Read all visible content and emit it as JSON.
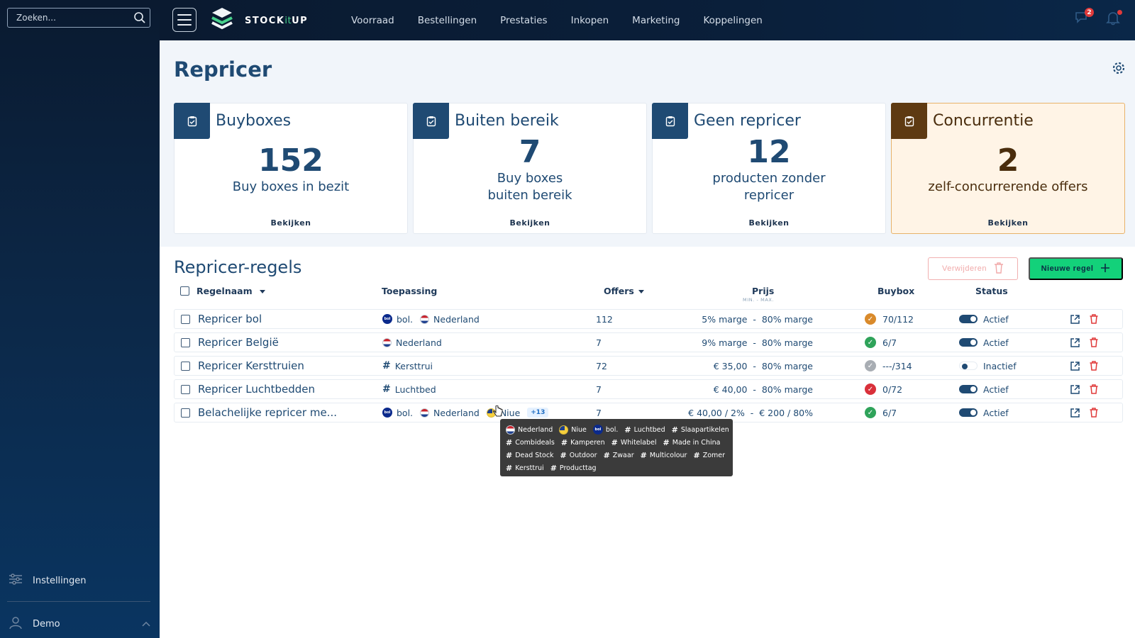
{
  "search": {
    "placeholder": "Zoeken..."
  },
  "brand": {
    "name_part1": "STOCK",
    "name_part2": "it",
    "name_part3": "UP"
  },
  "nav": [
    "Voorraad",
    "Bestellingen",
    "Prestaties",
    "Inkopen",
    "Marketing",
    "Koppelingen"
  ],
  "topbar": {
    "notification_count": "2"
  },
  "sidebar": {
    "settings": "Instellingen",
    "user": "Demo"
  },
  "page": {
    "title": "Repricer"
  },
  "cards": [
    {
      "title": "Buyboxes",
      "number": "152",
      "sub1": "Buy boxes in bezit",
      "sub2": "",
      "link": "Bekijken"
    },
    {
      "title": "Buiten bereik",
      "number": "7",
      "sub1": "Buy boxes",
      "sub2": "buiten bereik",
      "link": "Bekijken"
    },
    {
      "title": "Geen repricer",
      "number": "12",
      "sub1": "producten zonder",
      "sub2": "repricer",
      "link": "Bekijken"
    },
    {
      "title": "Concurrentie",
      "number": "2",
      "sub1": "zelf-concurrerende offers",
      "sub2": "",
      "link": "Bekijken"
    }
  ],
  "rules": {
    "title": "Repricer-regels",
    "delete_label": "Verwijderen",
    "new_label": "Nieuwe regel",
    "headers": {
      "name": "Regelnaam",
      "scope": "Toepassing",
      "offers": "Offers",
      "price": "Prijs",
      "price_sub": "MIN. - MAX.",
      "buybox": "Buybox",
      "status": "Status"
    },
    "rows": [
      {
        "name": "Repricer bol",
        "scope": {
          "bol": "bol.",
          "country": "Nederland"
        },
        "offers": "112",
        "price": "5% marge  -  80% marge",
        "buybox": "70/112",
        "buybox_state": "warn",
        "status": "Actief",
        "on": true
      },
      {
        "name": "Repricer België",
        "scope": {
          "country": "Nederland"
        },
        "offers": "7",
        "price": "9% marge  -  80% marge",
        "buybox": "6/7",
        "buybox_state": "ok",
        "status": "Actief",
        "on": true
      },
      {
        "name": "Repricer Kersttruien",
        "scope": {
          "tag": "Kersttrui"
        },
        "offers": "72",
        "price": "€ 35,00  -  80% marge",
        "buybox": "---/314",
        "buybox_state": "none",
        "status": "Inactief",
        "on": false
      },
      {
        "name": "Repricer Luchtbedden",
        "scope": {
          "tag": "Luchtbed"
        },
        "offers": "7",
        "price": "€ 40,00  -  80% marge",
        "buybox": "0/72",
        "buybox_state": "bad",
        "status": "Actief",
        "on": true
      },
      {
        "name": "Belachelijke repricer me...",
        "scope": {
          "bol": "bol.",
          "country": "Nederland",
          "country2": "Niue",
          "more": "+13"
        },
        "offers": "7",
        "price": "€ 40,00 / 2%  -  € 200 / 80%",
        "buybox": "6/7",
        "buybox_state": "ok",
        "status": "Actief",
        "on": true
      }
    ]
  },
  "tooltip": {
    "line1": {
      "nl": "Nederland",
      "nu": "Niue",
      "bol": "bol.",
      "tags": [
        "Luchtbed",
        "Slaapartikelen"
      ]
    },
    "line2": [
      "Combideals",
      "Kamperen",
      "Whitelabel",
      "Made in China"
    ],
    "line3": [
      "Dead Stock",
      "Outdoor",
      "Zwaar",
      "Multicolour",
      "Zomer"
    ],
    "line4": [
      "Kersttrui",
      "Producttag"
    ]
  },
  "colors": {
    "primary": "#1f4a73",
    "accent": "#13d17a",
    "danger": "#e03a3a",
    "warn_card": "#fff4e6"
  }
}
